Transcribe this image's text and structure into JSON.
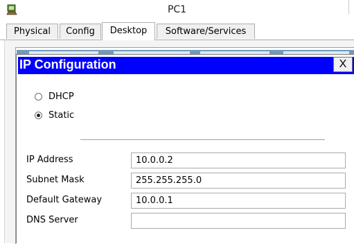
{
  "window": {
    "title": "PC1",
    "icon": "packet-tracer-pc-icon"
  },
  "tabs": [
    {
      "label": "Physical",
      "active": false
    },
    {
      "label": "Config",
      "active": false
    },
    {
      "label": "Desktop",
      "active": true
    },
    {
      "label": "Software/Services",
      "active": false
    }
  ],
  "dialog": {
    "title": "IP Configuration",
    "close_label": "X",
    "radios": [
      {
        "label": "DHCP",
        "selected": false
      },
      {
        "label": "Static",
        "selected": true
      }
    ],
    "fields": [
      {
        "label": "IP Address",
        "value": "10.0.0.2"
      },
      {
        "label": "Subnet Mask",
        "value": "255.255.255.0"
      },
      {
        "label": "Default Gateway",
        "value": "10.0.0.1"
      },
      {
        "label": "DNS Server",
        "value": ""
      }
    ]
  },
  "colors": {
    "dialog_title_bar": "#0000ff",
    "desktop_strip": "#6f9bbd"
  }
}
